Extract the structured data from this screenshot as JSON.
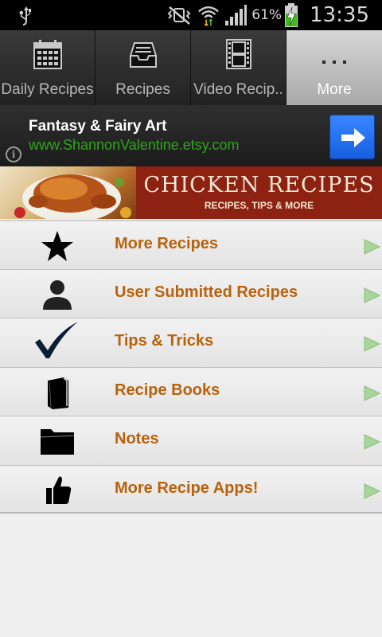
{
  "status_bar": {
    "battery_percent": "61%",
    "time": "13:35",
    "icons": [
      "usb-icon",
      "mute-vibrate-icon",
      "wifi-icon",
      "signal-icon",
      "battery-charging-icon"
    ]
  },
  "tabs": [
    {
      "label": "Daily Recipes",
      "icon": "calendar-icon",
      "active": false
    },
    {
      "label": "Recipes",
      "icon": "inbox-tray-icon",
      "active": false
    },
    {
      "label": "Video Recip..",
      "icon": "film-strip-icon",
      "active": false
    },
    {
      "label": "More",
      "icon": "more-dots-icon",
      "active": true
    }
  ],
  "ad": {
    "title": "Fantasy & Fairy Art",
    "url": "www.ShannonValentine.etsy.com",
    "info_label": "i",
    "button_icon": "arrow-right-icon"
  },
  "banner": {
    "title": "CHICKEN RECIPES",
    "subtitle": "RECIPES, TIPS & MORE"
  },
  "menu": {
    "items": [
      {
        "label": "More Recipes",
        "icon": "star-icon"
      },
      {
        "label": "User Submitted Recipes",
        "icon": "user-icon"
      },
      {
        "label": "Tips & Tricks",
        "icon": "checkmark-icon"
      },
      {
        "label": "Recipe Books",
        "icon": "book-icon"
      },
      {
        "label": "Notes",
        "icon": "folder-icon"
      },
      {
        "label": "More Recipe Apps!",
        "icon": "thumbs-up-icon"
      }
    ],
    "arrow_color": "#a6d69a"
  },
  "colors": {
    "menu_label": "#b8620c",
    "ad_url": "#2ea61a",
    "ad_button": "#2a74f0",
    "banner": "#8d2112"
  }
}
